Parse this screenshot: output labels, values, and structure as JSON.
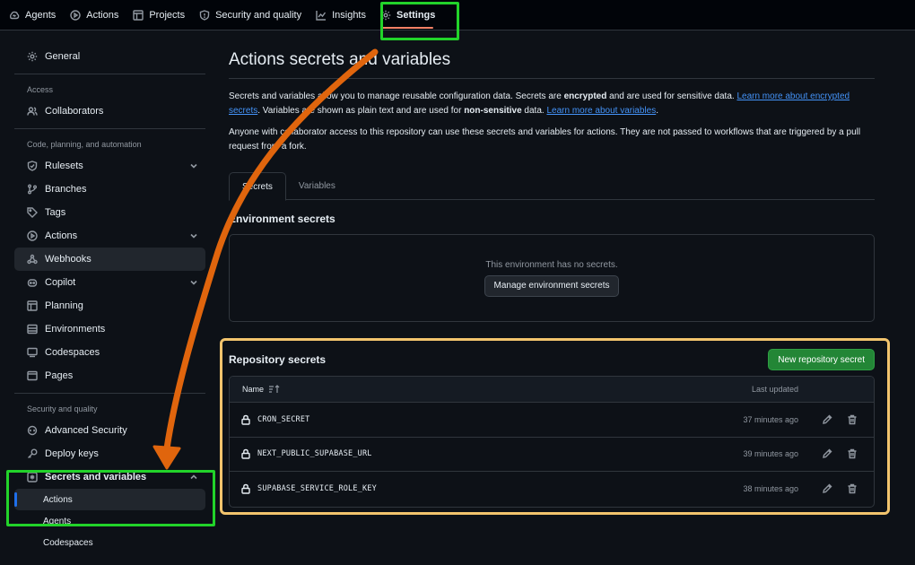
{
  "topnav": {
    "items": [
      {
        "label": "Agents",
        "icon": "agents-icon"
      },
      {
        "label": "Actions",
        "icon": "play-icon"
      },
      {
        "label": "Projects",
        "icon": "table-icon"
      },
      {
        "label": "Security and quality",
        "icon": "shield-icon"
      },
      {
        "label": "Insights",
        "icon": "graph-icon"
      },
      {
        "label": "Settings",
        "icon": "gear-icon",
        "active": true
      }
    ]
  },
  "sidebar": {
    "general": "General",
    "access_heading": "Access",
    "collaborators": "Collaborators",
    "code_heading": "Code, planning, and automation",
    "rulesets": "Rulesets",
    "branches": "Branches",
    "tags": "Tags",
    "actions": "Actions",
    "webhooks": "Webhooks",
    "copilot": "Copilot",
    "planning": "Planning",
    "environments": "Environments",
    "codespaces": "Codespaces",
    "pages": "Pages",
    "security_heading": "Security and quality",
    "advanced_security": "Advanced Security",
    "deploy_keys": "Deploy keys",
    "secrets_and_variables": "Secrets and variables",
    "sub_actions": "Actions",
    "sub_agents": "Agents",
    "sub_codespaces": "Codespaces"
  },
  "main": {
    "title": "Actions secrets and variables",
    "intro_1": "Secrets and variables allow you to manage reusable configuration data. Secrets are ",
    "intro_encrypted": "encrypted",
    "intro_2": " and are used for sensitive data. ",
    "intro_link_1": "Learn more about encrypted secrets",
    "intro_3": ". Variables are shown as plain text and are used for ",
    "intro_nonsensitive": "non-sensitive",
    "intro_4": " data. ",
    "intro_link_2": "Learn more about variables",
    "intro_5": ".",
    "access_note": "Anyone with collaborator access to this repository can use these secrets and variables for actions. They are not passed to workflows that are triggered by a pull request from a fork.",
    "tabs": [
      "Secrets",
      "Variables"
    ],
    "env_title": "Environment secrets",
    "env_empty": "This environment has no secrets.",
    "env_button": "Manage environment secrets",
    "repo_title": "Repository secrets",
    "new_secret_button": "New repository secret",
    "table": {
      "col_name": "Name",
      "col_updated": "Last updated",
      "rows": [
        {
          "name": "CRON_SECRET",
          "updated": "37 minutes ago"
        },
        {
          "name": "NEXT_PUBLIC_SUPABASE_URL",
          "updated": "39 minutes ago"
        },
        {
          "name": "SUPABASE_SERVICE_ROLE_KEY",
          "updated": "38 minutes ago"
        }
      ]
    }
  },
  "colors": {
    "highlight_green": "#22d32a",
    "highlight_yellow": "#f2c46d",
    "arrow_orange": "#e0650d",
    "primary_green": "#238636"
  }
}
